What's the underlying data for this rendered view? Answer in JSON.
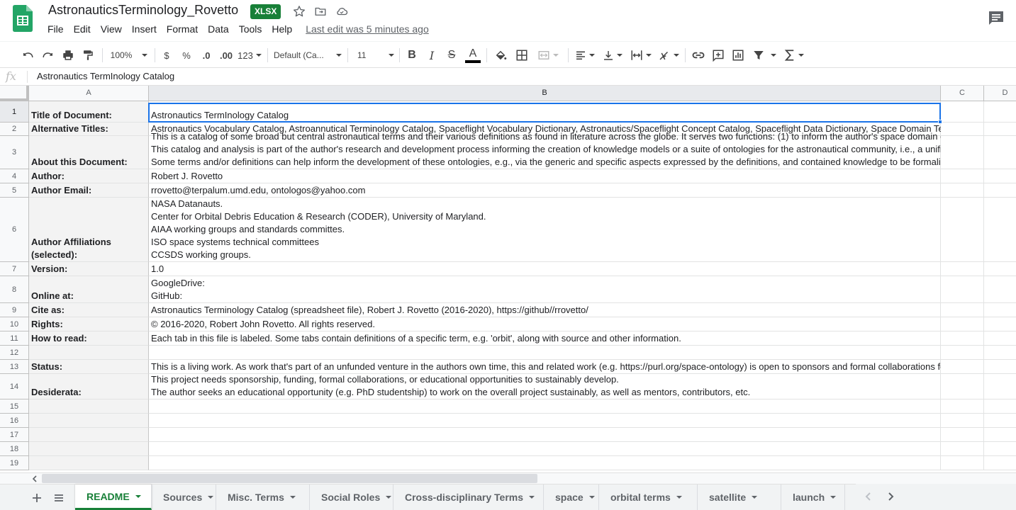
{
  "document": {
    "title": "AstronauticsTerminology_Rovetto",
    "badge": "XLSX"
  },
  "menu": {
    "items": [
      "File",
      "Edit",
      "View",
      "Insert",
      "Format",
      "Data",
      "Tools",
      "Help"
    ],
    "last_edit": "Last edit was 5 minutes ago"
  },
  "toolbar": {
    "zoom": "100%",
    "currency": "$",
    "percent": "%",
    "decrease_decimal": ".0",
    "increase_decimal": ".00",
    "more_formats": "123",
    "font": "Default (Ca...",
    "font_size": "11",
    "bold": "B",
    "italic": "I",
    "strike": "S",
    "text_color_glyph": "A"
  },
  "formula_bar": {
    "fx": "fx",
    "value": "Astronautics TermInology Catalog"
  },
  "columns": [
    "A",
    "B",
    "C",
    "D"
  ],
  "rows": [
    {
      "num": "1",
      "label": "Title of Document:",
      "value": [
        "Astronautics TermInology Catalog"
      ]
    },
    {
      "num": "2",
      "label": "Alternative Titles:",
      "value": [
        "Astronautics Vocabulary Catalog, Astroannutical Terminology Catalog, Spaceflight Vocabulary Dictionary, Astronautics/Spaceflight Concept Catalog, Spaceflight Data Dictionary, Space Domain Terminology Catalog"
      ]
    },
    {
      "num": "3",
      "label": "About this Document:",
      "value": [
        "This is a catalog of some broad but central astronautical terms and their various definitions as found in literature across the globe. It serves two functions: (1) to inform the author's space domain ontology suite,",
        "This catalog and analysis is part of the author's research and development process informing the creation of knowledge models or a suite of ontologies for the astronautical community, i.e., a unified reference",
        "Some terms and/or definitions can help inform the development of these ontologies, e.g., via the generic and specific aspects expressed by the definitions, and contained knowledge to be formalized in an ontology."
      ]
    },
    {
      "num": "4",
      "label": "Author:",
      "value": [
        "Robert J. Rovetto"
      ]
    },
    {
      "num": "5",
      "label": "Author Email:",
      "value": [
        "rrovetto@terpalum.umd.edu, ontologos@yahoo.com"
      ]
    },
    {
      "num": "6",
      "label": "Author Affiliations (selected):",
      "value": [
        "NASA Datanauts.",
        "Center for Orbital Debris Education & Research (CODER), University of Maryland.",
        "AIAA working groups and standards committes.",
        "ISO space systems technical committees",
        "CCSDS working groups."
      ]
    },
    {
      "num": "7",
      "label": "Version:",
      "value": [
        "1.0"
      ]
    },
    {
      "num": "8",
      "label": "Online at:",
      "value": [
        "GoogleDrive:",
        "GitHub:"
      ]
    },
    {
      "num": "9",
      "label": "Cite as:",
      "value": [
        "Astronautics Terminology Catalog (spreadsheet file), Robert J. Rovetto (2016-2020), https://github//rrovetto/"
      ]
    },
    {
      "num": "10",
      "label": "Rights:",
      "value": [
        "© 2016-2020, Robert John Rovetto. All rights reserved."
      ]
    },
    {
      "num": "11",
      "label": "How to read:",
      "value": [
        "Each tab in this file is labeled. Some tabs contain definitions of a specific term, e.g. 'orbit', along with source and other information."
      ]
    },
    {
      "num": "12",
      "label": "",
      "value": [
        ""
      ]
    },
    {
      "num": "13",
      "label": "Status:",
      "value": [
        "This is a living work. As work that's part of an unfunded venture in the authors own time, this and related work (e.g. https://purl.org/space-ontology) is open to sponsors and formal collaborations for sustainability."
      ]
    },
    {
      "num": "14",
      "label": "Desiderata:",
      "value": [
        "This project needs sponsorship, funding, formal collaborations, or educational opportunities to sustainably develop.",
        "The author seeks an educational opportunity (e.g. PhD studentship) to work on the overall project sustainably, as well as mentors, contributors, etc."
      ]
    },
    {
      "num": "15",
      "label": "",
      "value": [
        ""
      ]
    },
    {
      "num": "16",
      "label": "",
      "value": [
        ""
      ]
    },
    {
      "num": "17",
      "label": "",
      "value": [
        ""
      ]
    },
    {
      "num": "18",
      "label": "",
      "value": [
        ""
      ]
    },
    {
      "num": "19",
      "label": "",
      "value": [
        ""
      ]
    }
  ],
  "sheet_tabs": [
    {
      "label": "README",
      "active": true
    },
    {
      "label": "Sources",
      "active": false
    },
    {
      "label": "Misc. Terms",
      "active": false
    },
    {
      "label": "Social Roles",
      "active": false
    },
    {
      "label": "Cross-disciplinary Terms",
      "active": false
    },
    {
      "label": "space",
      "active": false
    },
    {
      "label": "orbital terms",
      "active": false
    },
    {
      "label": "satellite",
      "active": false
    },
    {
      "label": "launch",
      "active": false
    }
  ],
  "colors": {
    "brand_green": "#188038",
    "selection_blue": "#1a73e8",
    "header_gray": "#f8f9fa"
  },
  "icons": [
    "sheets-logo",
    "star-icon",
    "move-to-folder-icon",
    "cloud-status-icon",
    "comments-icon",
    "undo-icon",
    "redo-icon",
    "print-icon",
    "paint-format-icon",
    "fill-color-icon",
    "borders-icon",
    "merge-cells-icon",
    "align-left-icon",
    "vertical-align-icon",
    "text-wrap-icon",
    "text-rotate-icon",
    "link-icon",
    "insert-comment-icon",
    "insert-chart-icon",
    "filter-icon",
    "functions-icon",
    "add-sheet-icon",
    "all-sheets-icon"
  ]
}
